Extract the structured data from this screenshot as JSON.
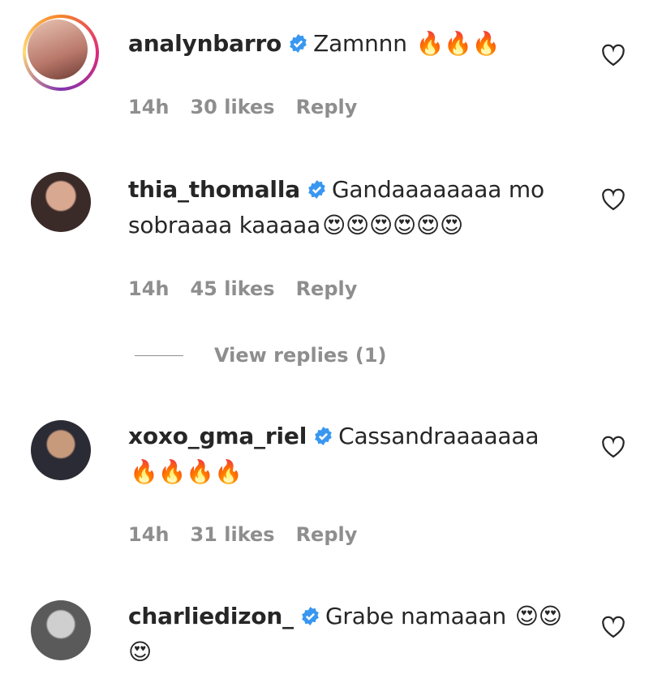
{
  "comments": [
    {
      "username": "analynbarro",
      "text": "Zamnnn",
      "emoji": "🔥🔥🔥",
      "time": "14h",
      "likes": "30 likes",
      "reply": "Reply"
    },
    {
      "username": "thia_thomalla",
      "text": "Gandaaaaaaaa mo sobraaaa kaaaaa",
      "emoji": "😍😍😍😍😍😍",
      "time": "14h",
      "likes": "45 likes",
      "reply": "Reply",
      "view_replies": "View replies (1)"
    },
    {
      "username": "xoxo_gma_riel",
      "text": "Cassandraaaaaaa",
      "emoji": "🔥🔥🔥🔥",
      "time": "14h",
      "likes": "31 likes",
      "reply": "Reply"
    },
    {
      "username": "charliedizon_",
      "text": "Grabe namaaan",
      "emoji": "😍😍😍",
      "time": "",
      "likes": "",
      "reply": ""
    }
  ],
  "icons": {
    "verified": "verified-badge-icon",
    "like": "heart-icon"
  },
  "colors": {
    "verified": "#3897f0",
    "muted": "#8e8e8e",
    "text": "#262626"
  }
}
